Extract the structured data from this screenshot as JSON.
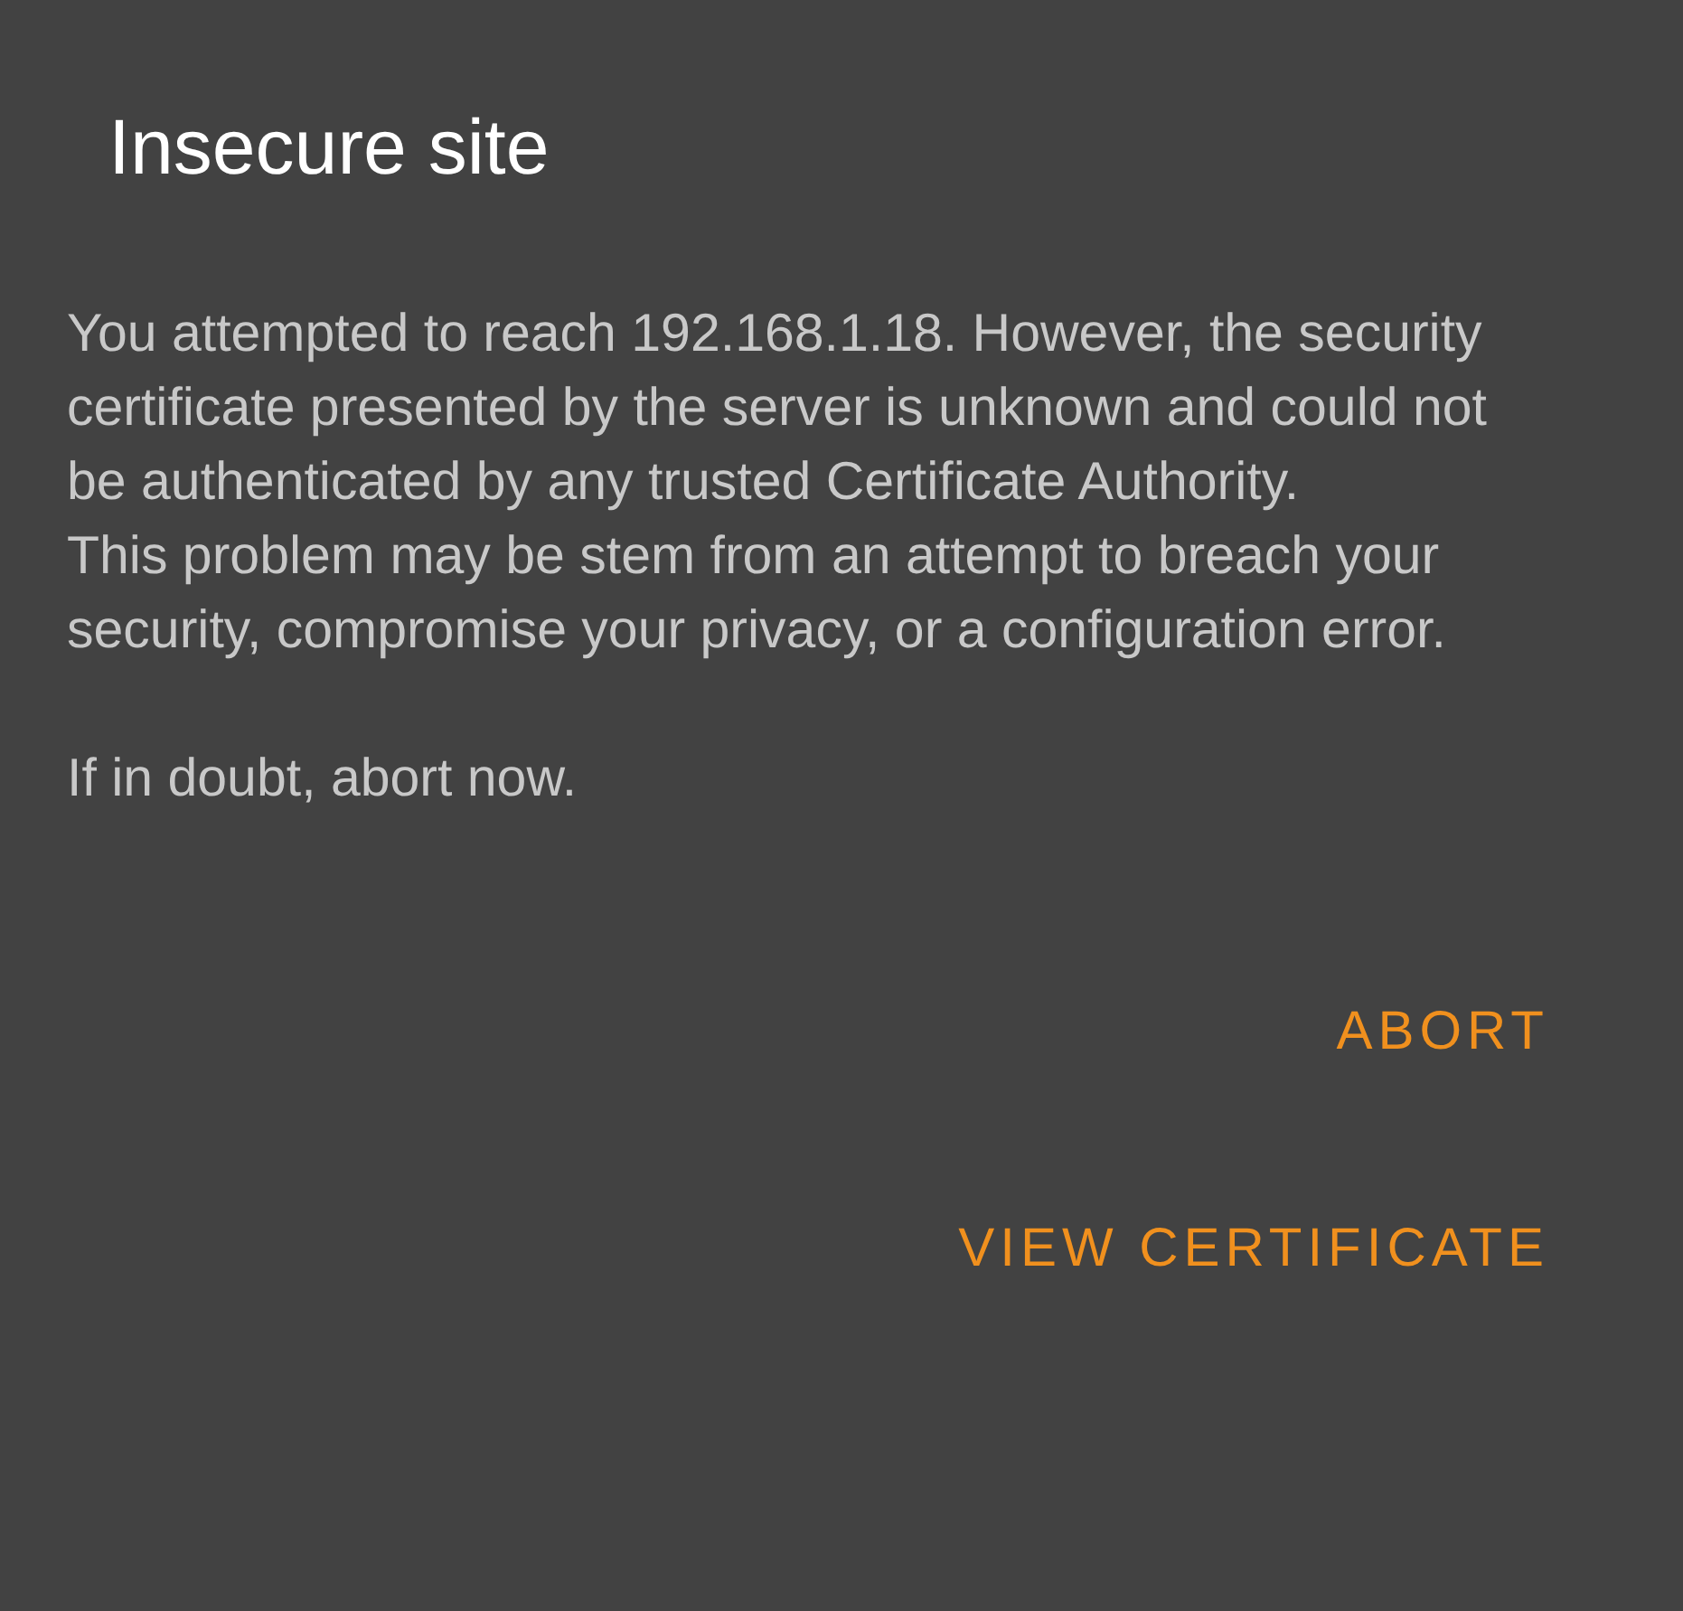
{
  "dialog": {
    "title": "Insecure site",
    "message": [
      "You attempted to reach 192.168.1.18. However, the security certificate presented by the server is unknown and could not be authenticated by any trusted Certificate Authority.",
      "This problem may be stem from an attempt to breach your security, compromise your privacy, or a configuration error."
    ],
    "note": "If in doubt, abort now.",
    "buttons": [
      "ABORT",
      "VIEW CERTIFICATE"
    ]
  }
}
